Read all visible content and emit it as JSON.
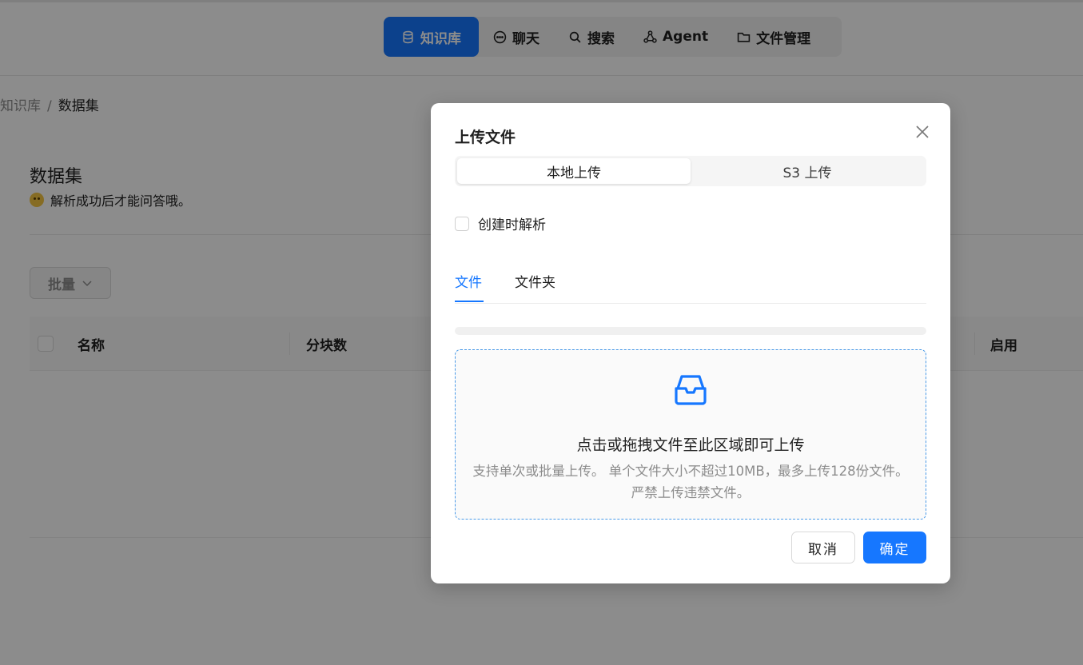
{
  "nav": {
    "items": [
      {
        "label": "知识库",
        "icon": "database-icon",
        "active": true
      },
      {
        "label": "聊天",
        "icon": "chat-bubble-icon"
      },
      {
        "label": "搜索",
        "icon": "search-icon"
      },
      {
        "label": "Agent",
        "icon": "agent-graph-icon"
      },
      {
        "label": "文件管理",
        "icon": "folder-icon"
      }
    ]
  },
  "breadcrumb": {
    "parent": "知识库",
    "separator": "/",
    "current": "数据集"
  },
  "dataset": {
    "title": "数据集",
    "subtitle": "解析成功后才能问答哦。"
  },
  "batch": {
    "label": "批量"
  },
  "table": {
    "columns": [
      "名称",
      "分块数",
      "启用"
    ]
  },
  "modal": {
    "title": "上传文件",
    "segments": [
      "本地上传",
      "S3 上传"
    ],
    "parse_on_create": {
      "label": "创建时解析",
      "checked": false
    },
    "tabs": [
      "文件",
      "文件夹"
    ],
    "progress": 0,
    "dropzone": {
      "title": "点击或拖拽文件至此区域即可上传",
      "hint": "支持单次或批量上传。 单个文件大小不超过10MB，最多上传128份文件。严禁上传违禁文件。"
    },
    "cancel_label": "取消",
    "ok_label": "确定"
  },
  "colors": {
    "accent": "#1677ff",
    "overlay": "rgba(0,0,0,0.45)"
  }
}
